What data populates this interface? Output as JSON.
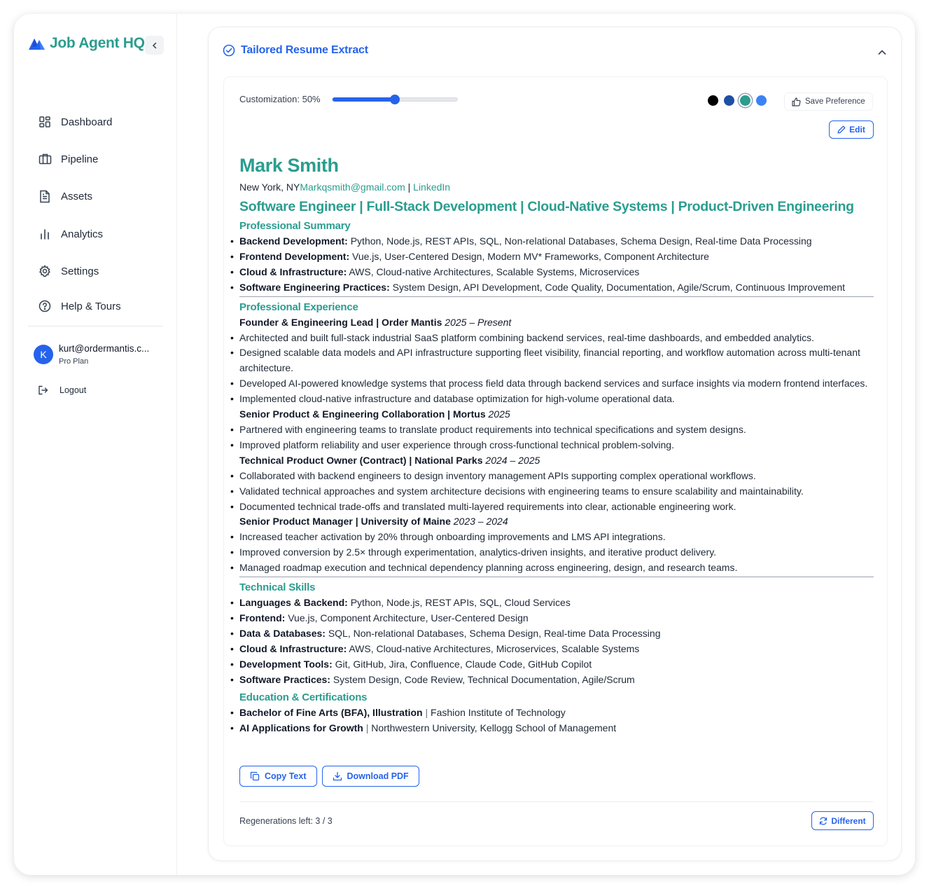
{
  "app": {
    "brand": "Job Agent HQ",
    "brand_color": "#2a9d8f",
    "accent_color": "#2563eb"
  },
  "sidebar": {
    "items": [
      {
        "label": "Dashboard",
        "icon": "grid-icon"
      },
      {
        "label": "Pipeline",
        "icon": "briefcase-icon"
      },
      {
        "label": "Assets",
        "icon": "document-icon"
      },
      {
        "label": "Analytics",
        "icon": "bar-chart-icon"
      },
      {
        "label": "Settings",
        "icon": "gear-icon"
      },
      {
        "label": "Help & Tours",
        "icon": "help-circle-icon"
      }
    ],
    "user": {
      "initial": "K",
      "email": "kurt@ordermantis.c...",
      "plan": "Pro Plan"
    },
    "logout_label": "Logout"
  },
  "panel": {
    "title": "Tailored Resume Extract",
    "customization_label": "Customization: 50%",
    "customization_level": 0.5,
    "swatches": [
      "#000000",
      "#1e4fa3",
      "#2a9d8f",
      "#3b82f6"
    ],
    "selected_swatch": 2,
    "save_pref_label": "Save Preference",
    "edit_label": "Edit",
    "copy_label": "Copy Text",
    "download_label": "Download PDF",
    "regen_label": "Regenerations left: 3 / 3",
    "different_label": "Different"
  },
  "resume": {
    "name": "Mark Smith",
    "location": "New York, NY",
    "email": "Markqsmith@gmail.com",
    "separator": " | ",
    "linkedin": "LinkedIn",
    "headline": "Software Engineer | Full-Stack Development | Cloud-Native Systems | Product-Driven Engineering",
    "summary_heading": "Professional Summary",
    "summary": [
      {
        "label": "Backend Development:",
        "text": " Python, Node.js, REST APIs, SQL, Non-relational Databases, Schema Design, Real-time Data Processing"
      },
      {
        "label": "Frontend Development:",
        "text": " Vue.js, User-Centered Design, Modern MV* Frameworks, Component Architecture"
      },
      {
        "label": "Cloud & Infrastructure:",
        "text": " AWS, Cloud-native Architectures, Scalable Systems, Microservices"
      },
      {
        "label": "Software Engineering Practices:",
        "text": " System Design, API Development, Code Quality, Documentation, Agile/Scrum, Continuous Improvement"
      }
    ],
    "experience_heading": "Professional Experience",
    "jobs": [
      {
        "title": "Founder & Engineering Lead | Order Mantis ",
        "dates": "2025 – Present",
        "bullets": [
          "Architected and built full-stack industrial SaaS platform combining backend services, real-time dashboards, and embedded analytics.",
          "Designed scalable data models and API infrastructure supporting fleet visibility, financial reporting, and workflow automation across multi-tenant architecture.",
          "Developed AI-powered knowledge systems that process field data through backend services and surface insights via modern frontend interfaces.",
          "Implemented cloud-native infrastructure and database optimization for high-volume operational data."
        ]
      },
      {
        "title": "Senior Product & Engineering Collaboration | Mortus ",
        "dates": "2025",
        "bullets": [
          "Partnered with engineering teams to translate product requirements into technical specifications and system designs.",
          "Improved platform reliability and user experience through cross-functional technical problem-solving."
        ]
      },
      {
        "title": "Technical Product Owner (Contract) | National Parks ",
        "dates": "2024 – 2025",
        "bullets": [
          "Collaborated with backend engineers to design inventory management APIs supporting complex operational workflows.",
          "Validated technical approaches and system architecture decisions with engineering teams to ensure scalability and maintainability.",
          "Documented technical trade-offs and translated multi-layered requirements into clear, actionable engineering work."
        ]
      },
      {
        "title": "Senior Product Manager | University of Maine ",
        "dates": "2023 – 2024",
        "bullets": [
          "Increased teacher activation by 20% through onboarding improvements and LMS API integrations.",
          "Improved conversion by 2.5× through experimentation, analytics-driven insights, and iterative product delivery.",
          "Managed roadmap execution and technical dependency planning across engineering, design, and research teams."
        ]
      }
    ],
    "skills_heading": "Technical Skills",
    "skills": [
      {
        "label": "Languages & Backend:",
        "text": " Python, Node.js, REST APIs, SQL, Cloud Services"
      },
      {
        "label": "Frontend:",
        "text": " Vue.js, Component Architecture, User-Centered Design"
      },
      {
        "label": "Data & Databases:",
        "text": " SQL, Non-relational Databases, Schema Design, Real-time Data Processing"
      },
      {
        "label": "Cloud & Infrastructure:",
        "text": " AWS, Cloud-native Architectures, Microservices, Scalable Systems"
      },
      {
        "label": "Development Tools:",
        "text": " Git, GitHub, Jira, Confluence, Claude Code, GitHub Copilot"
      },
      {
        "label": "Software Practices:",
        "text": " System Design, Code Review, Technical Documentation, Agile/Scrum"
      }
    ],
    "education_heading": "Education & Certifications",
    "education": [
      {
        "label": "Bachelor of Fine Arts (BFA), Illustration",
        "sep": " | ",
        "text": "Fashion Institute of Technology"
      },
      {
        "label": "AI Applications for Growth",
        "sep": " | ",
        "text": "Northwestern University, Kellogg School of Management"
      }
    ]
  }
}
